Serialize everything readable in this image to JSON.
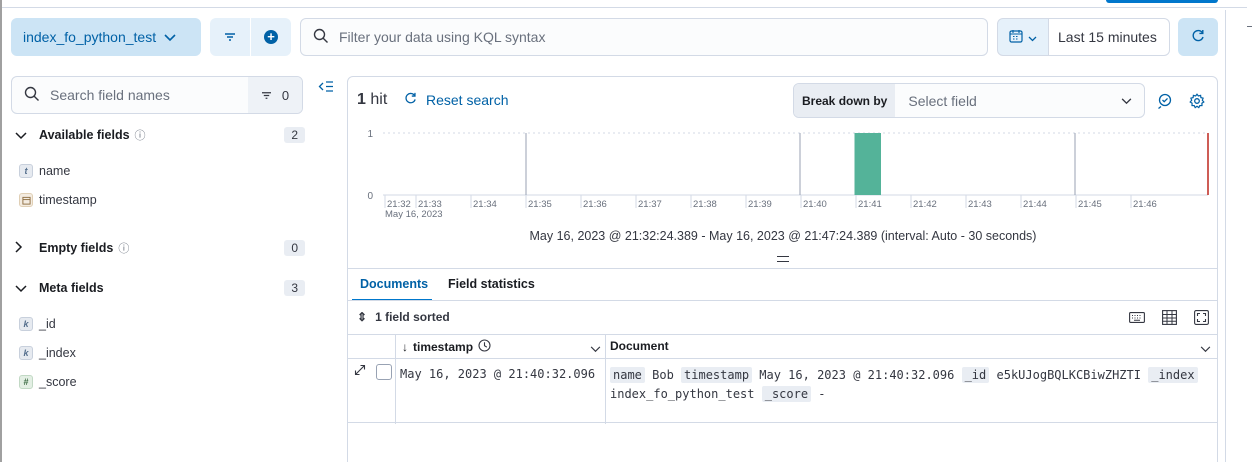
{
  "query_bar": {
    "data_view": "index_fo_python_test",
    "kql_placeholder": "Filter your data using KQL syntax",
    "time_range": "Last 15 minutes"
  },
  "sidebar": {
    "search_placeholder": "Search field names",
    "filter_count": "0",
    "groups": {
      "available": {
        "label": "Available fields",
        "count": "2",
        "fields": [
          {
            "type": "t",
            "name": "name"
          },
          {
            "type": "date",
            "name": "timestamp"
          }
        ]
      },
      "empty": {
        "label": "Empty fields",
        "count": "0"
      },
      "meta": {
        "label": "Meta fields",
        "count": "3",
        "fields": [
          {
            "type": "k",
            "name": "_id"
          },
          {
            "type": "k",
            "name": "_index"
          },
          {
            "type": "#",
            "name": "_score"
          }
        ]
      }
    }
  },
  "results": {
    "hit_count": "1",
    "hit_label": "hit",
    "reset_label": "Reset search",
    "breakdown_label": "Break down by",
    "breakdown_placeholder": "Select field",
    "time_range_text": "May 16, 2023 @ 21:32:24.389 - May 16, 2023 @ 21:47:24.389 (interval: Auto - 30 seconds)"
  },
  "chart_data": {
    "type": "bar",
    "x_ticks": [
      "21:32",
      "21:33",
      "21:34",
      "21:35",
      "21:36",
      "21:37",
      "21:38",
      "21:39",
      "21:40",
      "21:41",
      "21:42",
      "21:43",
      "21:44",
      "21:45",
      "21:46"
    ],
    "x_sublabel": "May 16, 2023",
    "y_ticks": [
      "1",
      "0"
    ],
    "ylim": [
      0,
      1
    ],
    "bars": [
      {
        "x": "21:40:30",
        "value": 1
      }
    ],
    "bar_color": "#54b399",
    "now_marker_color": "#bd271e"
  },
  "tabs": {
    "documents": "Documents",
    "field_statistics": "Field statistics"
  },
  "grid": {
    "sorted_label": "1 field sorted",
    "col_timestamp": "timestamp",
    "col_document": "Document",
    "row": {
      "timestamp": "May 16, 2023 @ 21:40:32.096",
      "doc_pairs": [
        {
          "k": "name",
          "v": "Bob"
        },
        {
          "k": "timestamp",
          "v": "May 16, 2023 @ 21:40:32.096"
        },
        {
          "k": "_id",
          "v": "e5kUJogBQLKCBiwZHZTI"
        },
        {
          "k": "_index",
          "v": "index_fo_python_test"
        },
        {
          "k": "_score",
          "v": "-"
        }
      ]
    }
  },
  "colors": {
    "primary": "#0061a6",
    "accent_bg": "#cce4f5",
    "border": "#d3dae6"
  }
}
